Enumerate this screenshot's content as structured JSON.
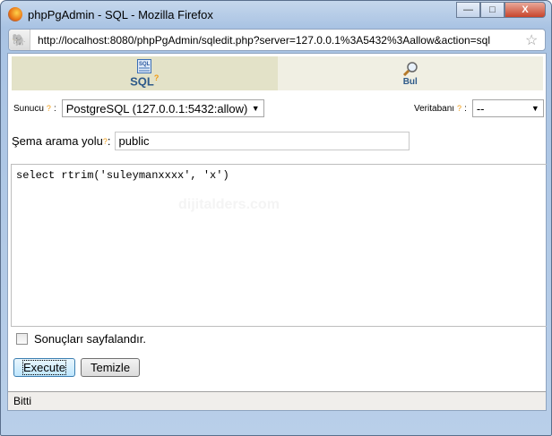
{
  "window": {
    "title": "phpPgAdmin - SQL - Mozilla Firefox",
    "minimize": "—",
    "maximize": "□",
    "close": "X"
  },
  "address_bar": {
    "url": "http://localhost:8080/phpPgAdmin/sqledit.php?server=127.0.0.1%3A5432%3Aallow&action=sql"
  },
  "tabs": [
    {
      "label": "SQL",
      "help": "?",
      "icon": "sql-icon"
    },
    {
      "label": "Bul",
      "icon": "magnifier-icon"
    }
  ],
  "server": {
    "label": "Sunucu",
    "help": "?",
    "colon": ":",
    "value": "PostgreSQL (127.0.0.1:5432:allow)"
  },
  "database": {
    "label": "Veritabanı",
    "help": "?",
    "colon": ":",
    "value": "--"
  },
  "schema": {
    "label": "Şema arama yolu",
    "help": "?",
    "colon": ":",
    "value": "public"
  },
  "query": "select rtrim('suleymanxxxx', 'x')",
  "watermark": "dijitalders.com",
  "paginate": {
    "label": "Sonuçları sayfalandır.",
    "checked": false
  },
  "buttons": {
    "execute": "Execute",
    "clear": "Temizle"
  },
  "status": "Bitti"
}
